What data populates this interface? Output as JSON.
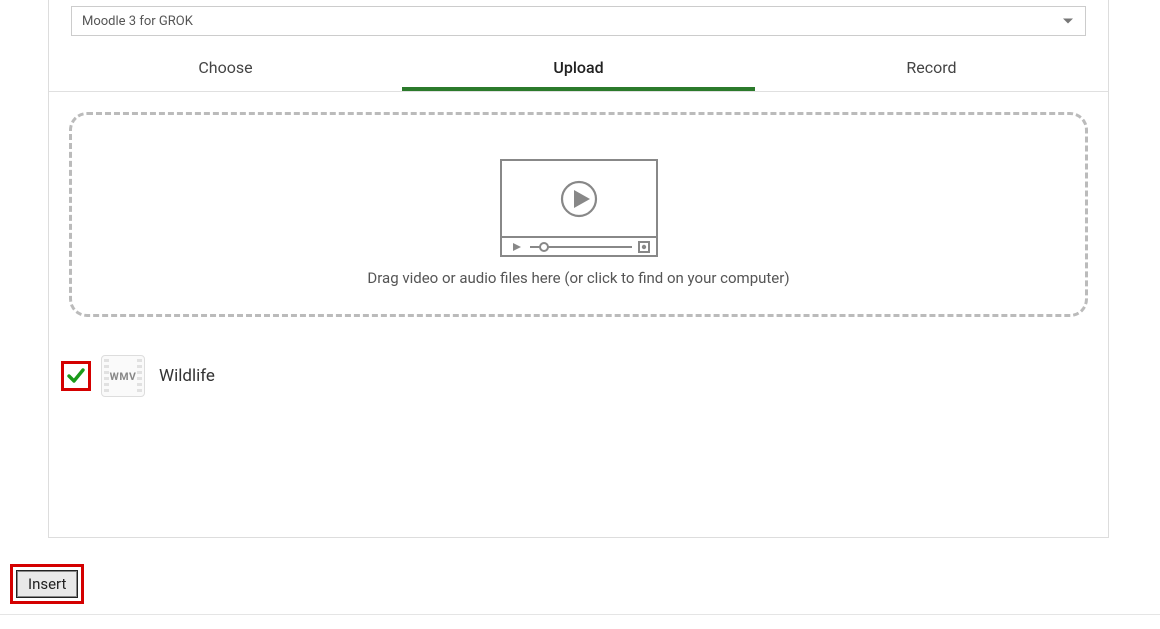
{
  "dropdown": {
    "value": "Moodle 3 for GROK"
  },
  "tabs": {
    "choose": "Choose",
    "upload": "Upload",
    "record": "Record",
    "active": "upload"
  },
  "dropzone": {
    "hint": "Drag video or audio files here (or click to find on your computer)"
  },
  "uploaded_file": {
    "checked": true,
    "ext_label": "WMV",
    "name": "Wildlife"
  },
  "footer": {
    "insert_label": "Insert"
  }
}
